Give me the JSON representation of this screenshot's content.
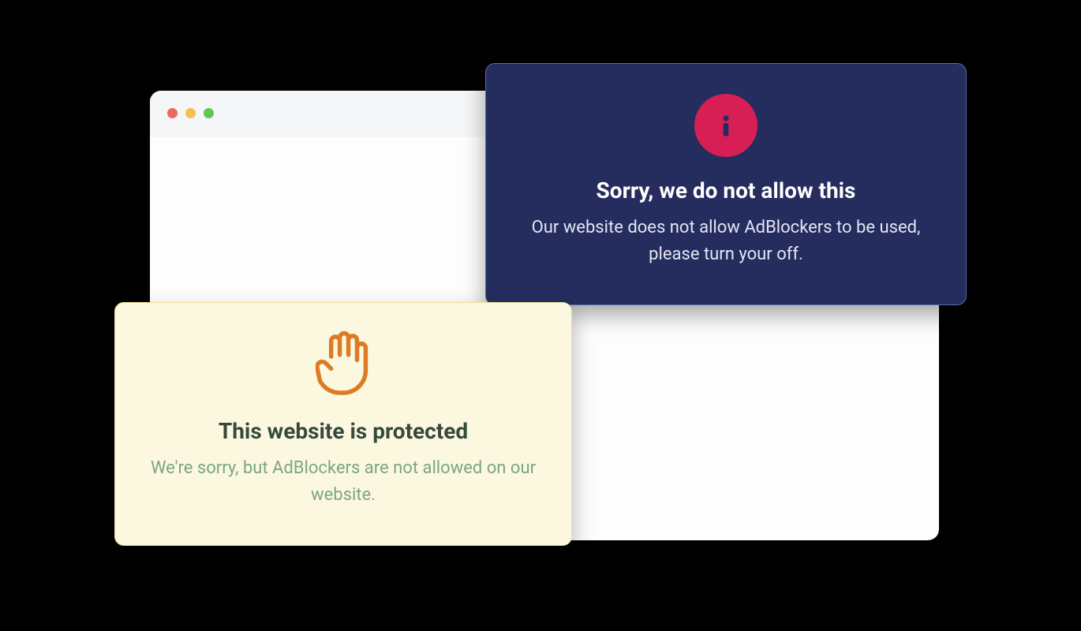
{
  "dark_card": {
    "title": "Sorry, we do not allow this",
    "body": "Our website does not allow AdBlockers to be used, please turn your off."
  },
  "light_card": {
    "title": "This website is protected",
    "body": "We're sorry, but AdBlockers are not allowed on our website."
  }
}
